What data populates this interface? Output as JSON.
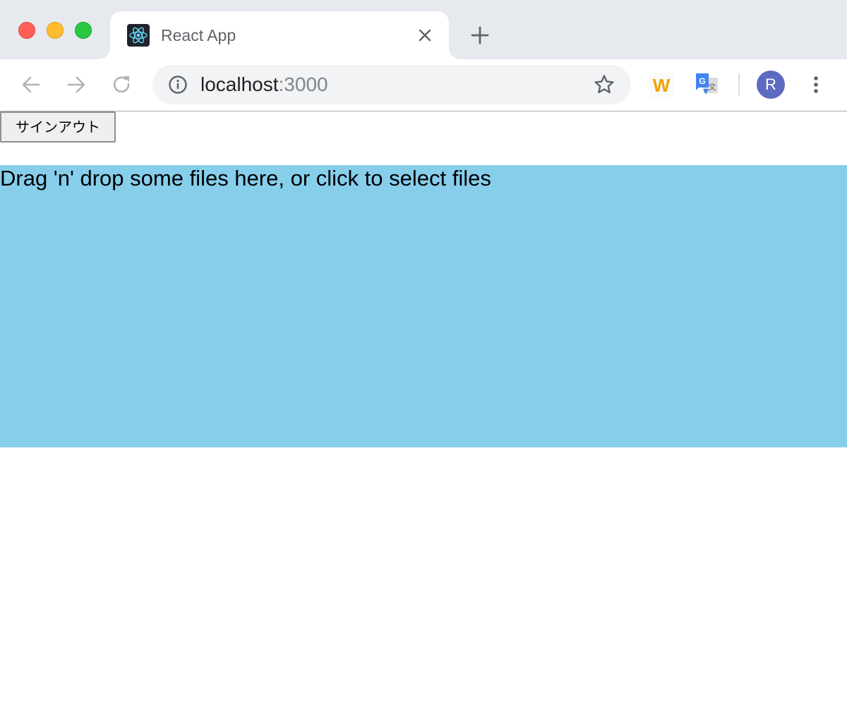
{
  "window": {
    "traffic_lights": [
      "close",
      "minimize",
      "zoom"
    ]
  },
  "tab": {
    "title": "React App",
    "favicon": "react-logo-icon",
    "close_icon": "close-icon"
  },
  "toolbar": {
    "back_icon": "arrow-left-icon",
    "forward_icon": "arrow-right-icon",
    "reload_icon": "reload-icon",
    "url_host": "localhost",
    "url_port": ":3000",
    "site_info_icon": "info-icon",
    "bookmark_icon": "star-icon",
    "extensions": {
      "w_label": "W",
      "translate_icon": "google-translate-icon"
    },
    "profile_initial": "R",
    "menu_icon": "more-vert-icon"
  },
  "page": {
    "signout_label": "サインアウト",
    "dropzone_text": "Drag 'n' drop some files here, or click to select files"
  },
  "colors": {
    "dropzone_background": "#87ceeb",
    "tabstrip_background": "#e6e9ed",
    "avatar_background": "#5c6bc0"
  }
}
